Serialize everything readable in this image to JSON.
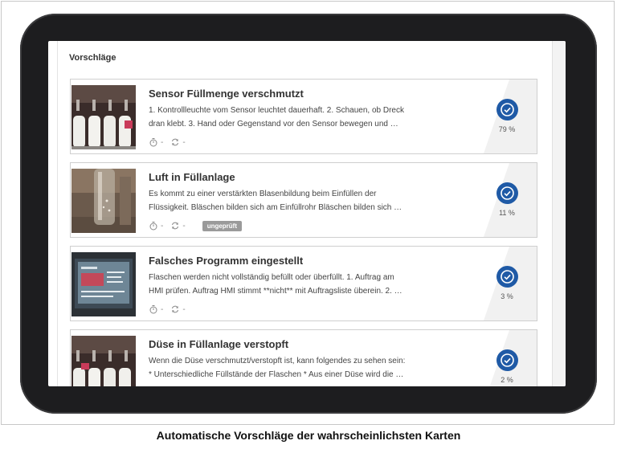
{
  "section": {
    "title": "Vorschläge"
  },
  "cards": [
    {
      "title": "Sensor Füllmenge verschmutzt",
      "line1": "1. Kontrollleuchte vom Sensor leuchtet dauerhaft.  2. Schauen, ob Dreck",
      "line2": "dran klebt.  3. Hand oder Gegenstand vor den Sensor bewegen und …",
      "score": "79 %",
      "dash1": "-",
      "dash2": "-",
      "image": "milk-bottles-filling-line-photo"
    },
    {
      "title": "Luft in Füllanlage",
      "line1": "Es kommt zu einer verstärkten Blasenbildung beim Einfüllen der",
      "line2": "Flüssigkeit.  Bläschen bilden sich am Einfüllrohr  Bläschen bilden sich …",
      "score": "11 %",
      "dash1": "-",
      "dash2": "-",
      "badge": "ungeprüft",
      "image": "glass-bottle-bubbles-photo"
    },
    {
      "title": "Falsches Programm eingestellt",
      "line1": "Flaschen werden nicht vollständig befüllt oder überfüllt.   1. Auftrag am",
      "line2": "HMI prüfen. Auftrag HMI stimmt **nicht** mit Auftragsliste überein.  2. …",
      "score": "3 %",
      "dash1": "-",
      "dash2": "-",
      "image": "hmi-panel-photo"
    },
    {
      "title": "Düse in Füllanlage verstopft",
      "line1": "Wenn die Düse verschmutzt/verstopft ist, kann folgendes zu sehen sein:",
      "line2": "* Unterschiedliche Füllstände der Flaschen  * Aus einer Düse wird die …",
      "score": "2 %",
      "dash1": "-",
      "dash2": "-",
      "image": "milk-bottles-nozzles-photo"
    }
  ],
  "icons": {
    "timer": "stopwatch-icon",
    "repeat": "repeat-icon",
    "score": "check-circle-icon"
  },
  "colors": {
    "accent": "#1f5aa6",
    "badge": "#9a9a9a"
  },
  "caption": "Automatische Vorschläge der wahrscheinlichsten Karten"
}
